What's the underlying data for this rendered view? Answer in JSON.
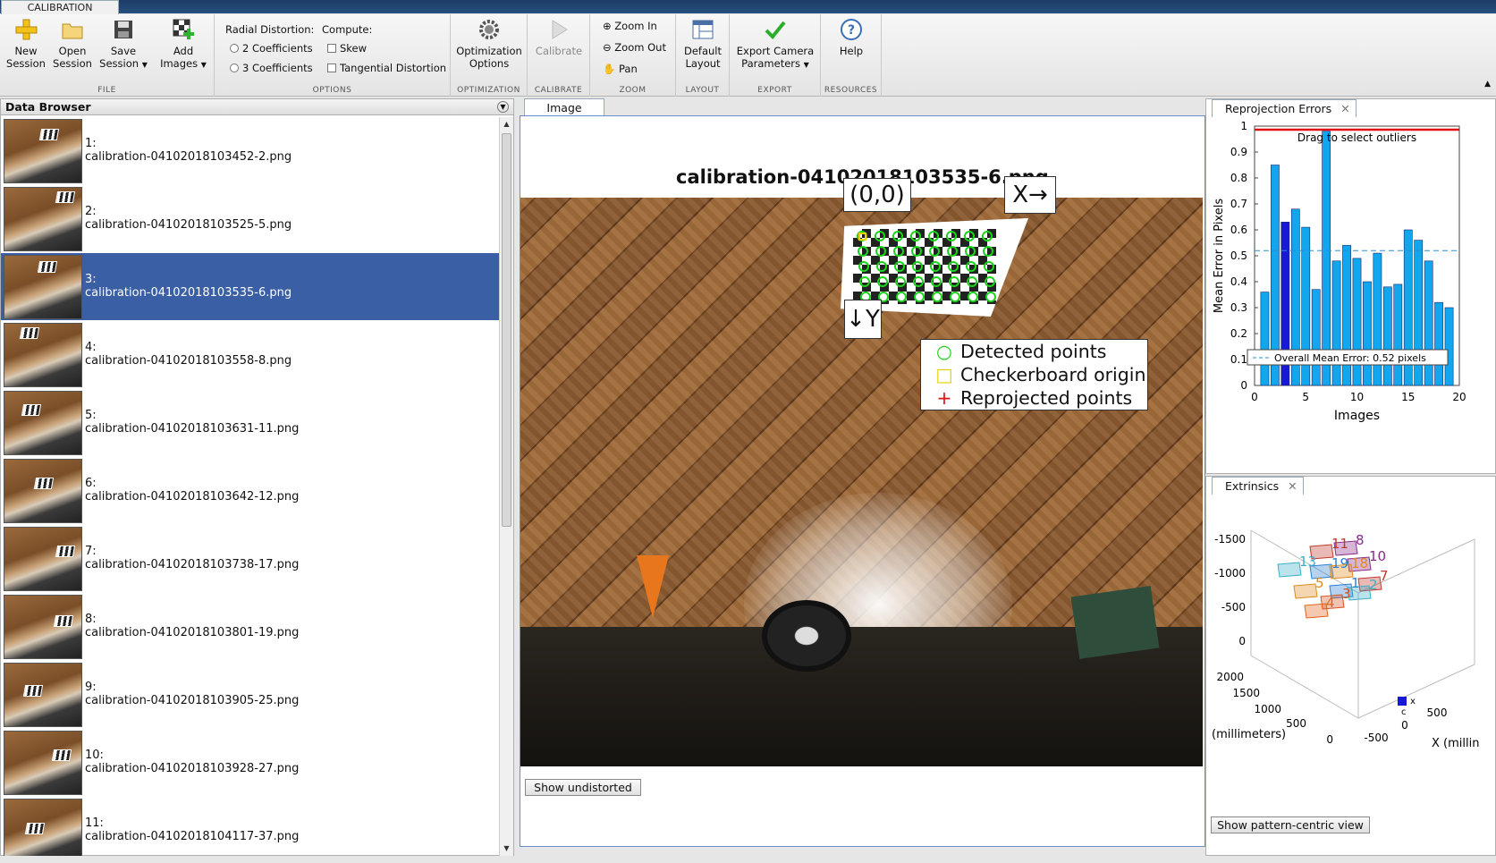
{
  "tab_label": "CALIBRATION",
  "ribbon": {
    "file": {
      "title": "FILE",
      "new_session": "New\nSession",
      "open_session": "Open\nSession",
      "save_session": "Save\nSession",
      "add_images": "Add\nImages"
    },
    "options": {
      "title": "OPTIONS",
      "radial_label": "Radial Distortion:",
      "compute_label": "Compute:",
      "radial_2": "2 Coefficients",
      "radial_3": "3 Coefficients",
      "skew": "Skew",
      "tangential": "Tangential Distortion"
    },
    "optimization": {
      "title": "OPTIMIZATION",
      "label": "Optimization\nOptions"
    },
    "calibrate": {
      "title": "CALIBRATE",
      "label": "Calibrate"
    },
    "zoom": {
      "title": "ZOOM",
      "zoom_in": "Zoom In",
      "zoom_out": "Zoom Out",
      "pan": "Pan"
    },
    "layout": {
      "title": "LAYOUT",
      "label": "Default\nLayout"
    },
    "export": {
      "title": "EXPORT",
      "label": "Export Camera\nParameters"
    },
    "resources": {
      "title": "RESOURCES",
      "help": "Help"
    }
  },
  "browser": {
    "title": "Data Browser",
    "items": [
      {
        "index": "1:",
        "name": "calibration-04102018103452-2.png"
      },
      {
        "index": "2:",
        "name": "calibration-04102018103525-5.png"
      },
      {
        "index": "3:",
        "name": "calibration-04102018103535-6.png"
      },
      {
        "index": "4:",
        "name": "calibration-04102018103558-8.png"
      },
      {
        "index": "5:",
        "name": "calibration-04102018103631-11.png"
      },
      {
        "index": "6:",
        "name": "calibration-04102018103642-12.png"
      },
      {
        "index": "7:",
        "name": "calibration-04102018103738-17.png"
      },
      {
        "index": "8:",
        "name": "calibration-04102018103801-19.png"
      },
      {
        "index": "9:",
        "name": "calibration-04102018103905-25.png"
      },
      {
        "index": "10:",
        "name": "calibration-04102018103928-27.png"
      },
      {
        "index": "11:",
        "name": "calibration-04102018104117-37.png"
      }
    ],
    "selected_index": 2
  },
  "image_panel": {
    "tab": "Image",
    "title": "calibration-04102018103535-6.png",
    "origin_label": "(0,0)",
    "x_label": "X→",
    "y_label": "↓Y",
    "legend": [
      "Detected points",
      "Checkerboard origin",
      "Reprojected points"
    ],
    "button": "Show undistorted"
  },
  "reprojection": {
    "tab": "Reprojection Errors",
    "drag_label": "Drag to select outliers",
    "mean_label": "Overall Mean Error: 0.52 pixels",
    "ylabel": "Mean Error in Pixels",
    "xlabel": "Images",
    "yticks": [
      "0",
      "0.1",
      "0.2",
      "0.3",
      "0.4",
      "0.5",
      "0.6",
      "0.7",
      "0.8",
      "0.9",
      "1"
    ],
    "xticks": [
      "0",
      "5",
      "10",
      "15",
      "20"
    ]
  },
  "chart_data": {
    "type": "bar",
    "categories": [
      "1",
      "2",
      "3",
      "4",
      "5",
      "6",
      "7",
      "8",
      "9",
      "10",
      "11",
      "12",
      "13",
      "14",
      "15",
      "16",
      "17",
      "18",
      "19"
    ],
    "values": [
      0.36,
      0.85,
      0.63,
      0.68,
      0.61,
      0.37,
      0.98,
      0.48,
      0.54,
      0.49,
      0.4,
      0.51,
      0.38,
      0.39,
      0.6,
      0.56,
      0.48,
      0.32,
      0.3
    ],
    "highlight_index": 2,
    "mean": 0.52,
    "ylim": [
      0,
      1
    ],
    "xlim": [
      0,
      20
    ],
    "xlabel": "Images",
    "ylabel": "Mean Error in Pixels",
    "colors": {
      "bar": "#12a6ee",
      "highlight": "#1818d8",
      "mean_line": "#2a8fd0",
      "threshold": "#e01010"
    }
  },
  "extrinsics": {
    "tab": "Extrinsics",
    "zticks": [
      "-1500",
      "-1000",
      "-500",
      "0"
    ],
    "yticks": [
      "2000",
      "1500",
      "1000",
      "500",
      "0"
    ],
    "xticks": [
      "-500",
      "0",
      "500"
    ],
    "ylabel": "(millimeters)",
    "xlabel": "X (millin",
    "board_labels": [
      "8",
      "11",
      "10",
      "13",
      "19",
      "18",
      "7",
      "5",
      "1",
      "2",
      "3",
      "4"
    ],
    "button": "Show pattern-centric view"
  }
}
